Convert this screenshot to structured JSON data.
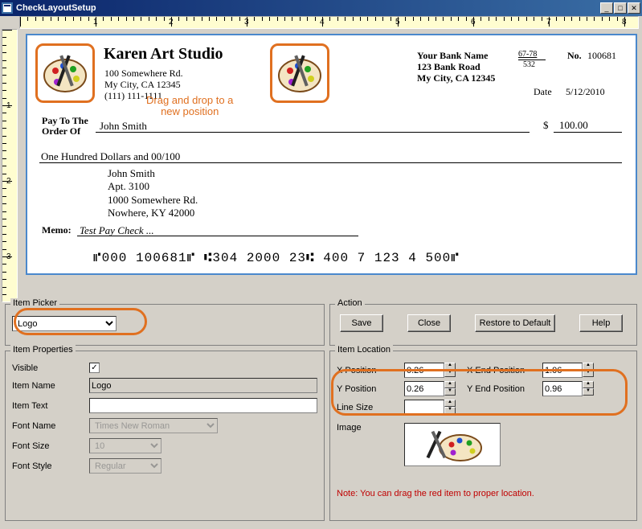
{
  "window": {
    "title": "CheckLayoutSetup"
  },
  "ruler_labels": [
    "1",
    "2",
    "3",
    "4",
    "5",
    "6",
    "7",
    "8"
  ],
  "vruler_labels": [
    "1",
    "2",
    "3"
  ],
  "check": {
    "company_name": "Karen Art Studio",
    "company_addr1": "100 Somewhere Rd.",
    "company_addr2": "My City, CA 12345",
    "company_phone": "(111) 111-1111",
    "bank_name": "Your Bank Name",
    "bank_addr1": "123 Bank Road",
    "bank_addr2": "My City, CA 12345",
    "routing_top": "67-78",
    "routing_bottom": "532",
    "no_label": "No.",
    "check_no": "100681",
    "date_label": "Date",
    "date_value": "5/12/2010",
    "drag_hint": "Drag and drop to a\nnew position",
    "pay_to_label": "Pay To The\nOrder Of",
    "payee": "John Smith",
    "dollar": "$",
    "amount_num": "100.00",
    "amount_words": "One Hundred  Dollars and 00/100",
    "addr_line1": "John Smith",
    "addr_line2": "Apt. 3100",
    "addr_line3": "1000 Somewhere Rd.",
    "addr_line4": "Nowhere, KY 42000",
    "memo_label": "Memo:",
    "memo_value": "Test Pay Check ...",
    "micr": "⑈000 100681⑈  ⑆304 2000 23⑆  400 7 123 4 500⑈"
  },
  "picker": {
    "legend": "Item Picker",
    "selected": "Logo"
  },
  "properties": {
    "legend": "Item Properties",
    "visible_label": "Visible",
    "visible_checked": true,
    "item_name_label": "Item Name",
    "item_name_value": "Logo",
    "item_text_label": "Item Text",
    "item_text_value": "",
    "font_name_label": "Font Name",
    "font_name_value": "Times New Roman",
    "font_size_label": "Font Size",
    "font_size_value": "10",
    "font_style_label": "Font Style",
    "font_style_value": "Regular"
  },
  "actions": {
    "legend": "Action",
    "save": "Save",
    "close": "Close",
    "restore": "Restore to Default",
    "help": "Help"
  },
  "location": {
    "legend": "Item Location",
    "x_label": "X Position",
    "x_value": "0.26",
    "xend_label": "X End Position",
    "xend_value": "1.06",
    "y_label": "Y Position",
    "y_value": "0.26",
    "yend_label": "Y End Position",
    "yend_value": "0.96",
    "line_size_label": "Line Size",
    "line_size_value": "",
    "image_label": "Image",
    "note": "Note: You can drag the red item to proper location."
  }
}
